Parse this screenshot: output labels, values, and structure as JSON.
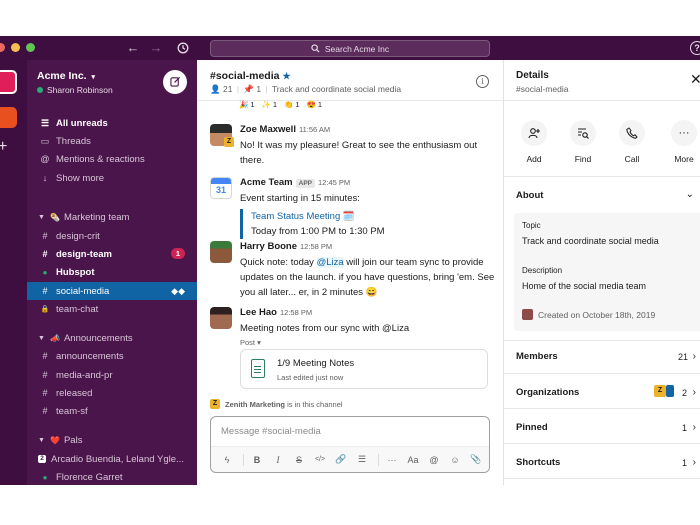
{
  "window": {
    "controls": [
      "#ed6a5e",
      "#f5bf4f",
      "#61c554"
    ],
    "search_placeholder": "Search Acme Inc"
  },
  "workspace": {
    "name": "Acme Inc.",
    "user": "Sharon Robinson"
  },
  "sidebar": {
    "top_items": [
      {
        "label": "All unreads",
        "icon": "list-icon",
        "bold": true
      },
      {
        "label": "Threads",
        "icon": "thread-icon"
      },
      {
        "label": "Mentions & reactions",
        "icon": "at-icon"
      },
      {
        "label": "Show more",
        "icon": "arrow-down-icon"
      }
    ],
    "sections": [
      {
        "title": "Marketing team",
        "emoji": "🌯",
        "items": [
          {
            "label": "design-crit",
            "prefix": "#"
          },
          {
            "label": "design-team",
            "prefix": "#",
            "bold": true,
            "badge": "1"
          },
          {
            "label": "Hubspot",
            "prefix": "●",
            "bold": true
          },
          {
            "label": "social-media",
            "prefix": "#",
            "active": true
          },
          {
            "label": "team-chat",
            "prefix": "🔒"
          }
        ]
      },
      {
        "title": "Announcements",
        "emoji": "📣",
        "items": [
          {
            "label": "announcements",
            "prefix": "#"
          },
          {
            "label": "media-and-pr",
            "prefix": "#"
          },
          {
            "label": "released",
            "prefix": "#"
          },
          {
            "label": "team-sf",
            "prefix": "#"
          }
        ]
      },
      {
        "title": "Pals",
        "emoji": "❤️",
        "items": [
          {
            "label": "Arcadio Buendia, Leland Ygle...",
            "prefix": "2"
          },
          {
            "label": "Florence Garret",
            "prefix": "●"
          }
        ]
      }
    ]
  },
  "channel": {
    "name": "#social-media",
    "members": "21",
    "pins": "1",
    "topic": "Track and coordinate social media",
    "reactions": [
      {
        "emoji": "🎉",
        "count": "1"
      },
      {
        "emoji": "✨",
        "count": "1"
      },
      {
        "emoji": "👏",
        "count": "1"
      },
      {
        "emoji": "😍",
        "count": "1"
      }
    ]
  },
  "messages": [
    {
      "author": "Zoe Maxwell",
      "time": "11:56 AM",
      "text": "No! It was my pleasure! Great to see the enthusiasm out there."
    },
    {
      "author": "Acme Team",
      "tag": "APP",
      "time": "12:45 PM",
      "text": "Event starting in 15 minutes:",
      "event_title": "Team Status Meeting 🗓️",
      "event_time": "Today from 1:00 PM to 1:30 PM"
    },
    {
      "author": "Harry Boone",
      "time": "12:58 PM",
      "text_before": "Quick note: today ",
      "mention": "@Liza",
      "text_after": " will join our team sync to provide updates on the launch. if you have questions, bring 'em. See you all later... er, in 2 minutes 😄"
    },
    {
      "author": "Lee Hao",
      "time": "12:58 PM",
      "text": "Meeting notes from our sync with @Liza",
      "post_label": "Post ▾",
      "post_title": "1/9 Meeting Notes",
      "post_sub": "Last edited just now"
    }
  ],
  "joined_notice": {
    "name": "Zenith Marketing",
    "text": " is in this channel"
  },
  "composer": {
    "placeholder": "Message #social-media"
  },
  "details": {
    "title": "Details",
    "subtitle": "#social-media",
    "actions": [
      {
        "label": "Add",
        "icon": "add-person-icon"
      },
      {
        "label": "Find",
        "icon": "find-icon"
      },
      {
        "label": "Call",
        "icon": "phone-icon"
      },
      {
        "label": "More",
        "icon": "more-icon"
      }
    ],
    "about_title": "About",
    "topic_label": "Topic",
    "topic_value": "Track and coordinate social media",
    "description_label": "Description",
    "description_value": "Home of the social media team",
    "created": "Created on October 18th, 2019",
    "sections": [
      {
        "label": "Members",
        "count": "21"
      },
      {
        "label": "Organizations",
        "count": "2"
      },
      {
        "label": "Pinned",
        "count": "1"
      },
      {
        "label": "Shortcuts",
        "count": "1"
      }
    ]
  }
}
